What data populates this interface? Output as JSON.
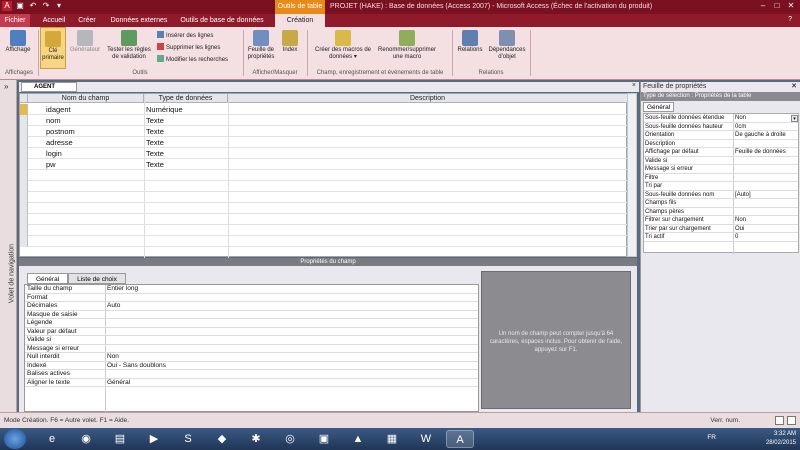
{
  "window": {
    "title": "PROJET (HAKE) : Base de données (Access 2007) - Microsoft Access (Échec de l'activation du produit)",
    "context_tab": "Outils de table"
  },
  "tabs": [
    "Fichier",
    "Accueil",
    "Créer",
    "Données externes",
    "Outils de base de données",
    "Création"
  ],
  "ribbon": {
    "affichage": {
      "btn": "Affichage",
      "group": "Affichages"
    },
    "outils": {
      "cle": "Clé primaire",
      "generateur": "Générateur",
      "tester": "Tester les règles de validation",
      "inserer": "Insérer des lignes",
      "supprimer": "Supprimer les lignes",
      "modifier": "Modifier les recherches",
      "group": "Outils"
    },
    "afficher": {
      "feuille": "Feuille de propriétés",
      "index": "Index",
      "group": "Afficher/Masquer"
    },
    "macros": {
      "creer": "Créer des macros de données ▾",
      "renommer": "Renommer/supprimer une macro",
      "group": "Champ, enregistrement et événements de table"
    },
    "relations": {
      "rel": "Relations",
      "dep": "Dépendances d'objet",
      "group": "Relations"
    }
  },
  "nav": {
    "label": "Volet de navigation",
    "chevron": "»"
  },
  "doc_tab": {
    "label": "AGENT",
    "close": "×"
  },
  "grid": {
    "headers": [
      "Nom du champ",
      "Type de données",
      "Description"
    ],
    "rows": [
      {
        "name": "idagent",
        "type": "Numérique"
      },
      {
        "name": "nom",
        "type": "Texte"
      },
      {
        "name": "postnom",
        "type": "Texte"
      },
      {
        "name": "adresse",
        "type": "Texte"
      },
      {
        "name": "login",
        "type": "Texte"
      },
      {
        "name": "pw",
        "type": "Texte"
      }
    ]
  },
  "field_props": {
    "title": "Propriétés du champ",
    "tabs": [
      "Général",
      "Liste de choix"
    ],
    "rows": [
      {
        "k": "Taille du champ",
        "v": "Entier long"
      },
      {
        "k": "Format",
        "v": ""
      },
      {
        "k": "Décimales",
        "v": "Auto"
      },
      {
        "k": "Masque de saisie",
        "v": ""
      },
      {
        "k": "Légende",
        "v": ""
      },
      {
        "k": "Valeur par défaut",
        "v": ""
      },
      {
        "k": "Valide si",
        "v": ""
      },
      {
        "k": "Message si erreur",
        "v": ""
      },
      {
        "k": "Null interdit",
        "v": "Non"
      },
      {
        "k": "Indexé",
        "v": "Oui - Sans doublons"
      },
      {
        "k": "Balises actives",
        "v": ""
      },
      {
        "k": "Aligner le texte",
        "v": "Général"
      }
    ],
    "help": "Un nom de champ peut compter jusqu'à 64 caractères, espaces inclus. Pour obtenir de l'aide, appuyez sur F1."
  },
  "prop_sheet": {
    "title": "Feuille de propriétés",
    "subtitle": "Type de sélection : Propriétés de la table",
    "tab": "Général",
    "rows": [
      {
        "k": "Sous-feuille données étendue",
        "v": "Non"
      },
      {
        "k": "Sous-feuille données hauteur",
        "v": "0cm"
      },
      {
        "k": "Orientation",
        "v": "De gauche à droite"
      },
      {
        "k": "Description",
        "v": ""
      },
      {
        "k": "Affichage par défaut",
        "v": "Feuille de données"
      },
      {
        "k": "Valide si",
        "v": ""
      },
      {
        "k": "Message si erreur",
        "v": ""
      },
      {
        "k": "Filtre",
        "v": ""
      },
      {
        "k": "Tri par",
        "v": ""
      },
      {
        "k": "Sous-feuille données nom",
        "v": "[Auto]"
      },
      {
        "k": "Champs fils",
        "v": ""
      },
      {
        "k": "Champs pères",
        "v": ""
      },
      {
        "k": "Filtrer sur chargement",
        "v": "Non"
      },
      {
        "k": "Trier par sur chargement",
        "v": "Oui"
      },
      {
        "k": "Tri actif",
        "v": "0"
      }
    ]
  },
  "status": {
    "left": "Mode Création. F6 = Autre volet. F1 = Aide.",
    "right": "Verr. num."
  },
  "tray": {
    "lang": "FR",
    "time": "3:32 AM",
    "date": "28/02/2015"
  }
}
